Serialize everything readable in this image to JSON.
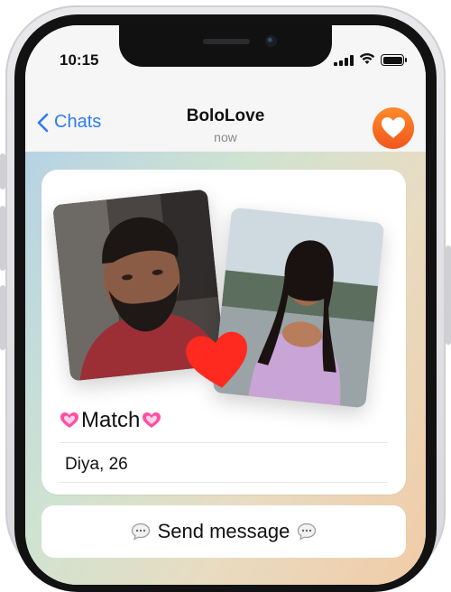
{
  "status_bar": {
    "time": "10:15"
  },
  "header": {
    "back_label": "Chats",
    "title": "BoloLove",
    "subtitle": "now"
  },
  "card": {
    "match_label": "Match",
    "profile_name": "Diya, 26"
  },
  "actions": {
    "send_message_label": "Send message"
  },
  "colors": {
    "accent_blue": "#2f7bf5",
    "avatar_orange": "#f1561d",
    "heart_red": "#ff2a1f",
    "match_heart_pink": "#ff4fa3"
  },
  "icons": [
    "back-chevron-icon",
    "avatar-heart-icon",
    "heart-icon",
    "pink-heart-icon",
    "speech-bubble-icon",
    "signal-icon",
    "wifi-icon",
    "battery-icon"
  ]
}
